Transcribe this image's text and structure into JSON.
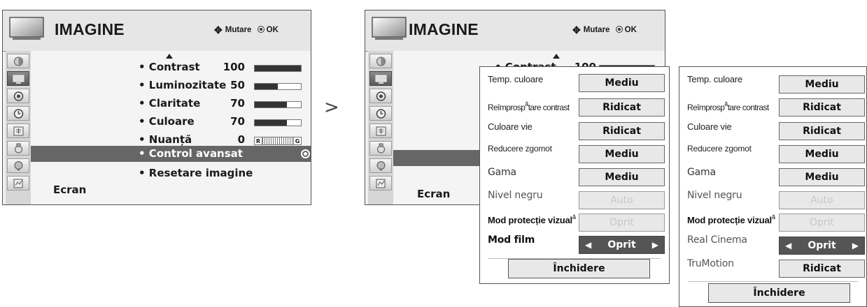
{
  "menu": {
    "title": "IMAGINE",
    "hint_move": "Mutare",
    "hint_ok": "OK",
    "rows": [
      {
        "label": "• Contrast",
        "value": "100",
        "level": 1.0
      },
      {
        "label": "• Luminozitate",
        "value": "50",
        "level": 0.5
      },
      {
        "label": "• Claritate",
        "value": "70",
        "level": 0.7
      },
      {
        "label": "• Culoare",
        "value": "70",
        "level": 0.7
      },
      {
        "label": "• Nuanță",
        "value": "0",
        "level": 0.5
      }
    ],
    "tint_r": "R",
    "tint_g": "G",
    "selected": "• Control avansat",
    "reset": "• Resetare imagine",
    "footer": "Ecran",
    "sidebar_icons": [
      "picture-mode-icon",
      "screen-icon",
      "audio-icon",
      "time-icon",
      "lock-icon",
      "option-icon",
      "input-icon",
      "usb-icon"
    ]
  },
  "popup1": {
    "rows": [
      {
        "label": "Temp. culoare",
        "value": "Mediu"
      },
      {
        "label": "Reîmprosp",
        "sup": "ă",
        "label2": "tare contrast",
        "value": "Ridicat"
      },
      {
        "label": "Culoare vie",
        "value": "Ridicat"
      },
      {
        "label": "Reducere zgomot",
        "value": "Mediu"
      },
      {
        "label": "Gama",
        "value": "Mediu"
      },
      {
        "label": "Nivel negru",
        "value": "Auto"
      },
      {
        "label": "Mod protecție vizual",
        "sup": "ă",
        "value": "Oprit"
      },
      {
        "label": "Mod film",
        "value": "Oprit"
      }
    ],
    "close": "Închidere"
  },
  "popup2": {
    "rows": [
      {
        "label": "Temp. culoare",
        "value": "Mediu"
      },
      {
        "label": "Reîmprosp",
        "sup": "ă",
        "label2": "tare contrast",
        "value": "Ridicat"
      },
      {
        "label": "Culoare vie",
        "value": "Ridicat"
      },
      {
        "label": "Reducere zgomot",
        "value": "Mediu"
      },
      {
        "label": "Gama",
        "value": "Mediu"
      },
      {
        "label": "Nivel negru",
        "value": "Auto"
      },
      {
        "label": "Mod protecție vizual",
        "sup": "ă",
        "value": "Oprit"
      },
      {
        "label": "Real Cinema",
        "value": "Oprit"
      },
      {
        "label": "TruMotion",
        "value": "Ridicat"
      }
    ],
    "close": "Închidere"
  },
  "colors": {
    "selected_row": "#666666",
    "panel": "#f0f0f0",
    "active_box": "#555555"
  }
}
